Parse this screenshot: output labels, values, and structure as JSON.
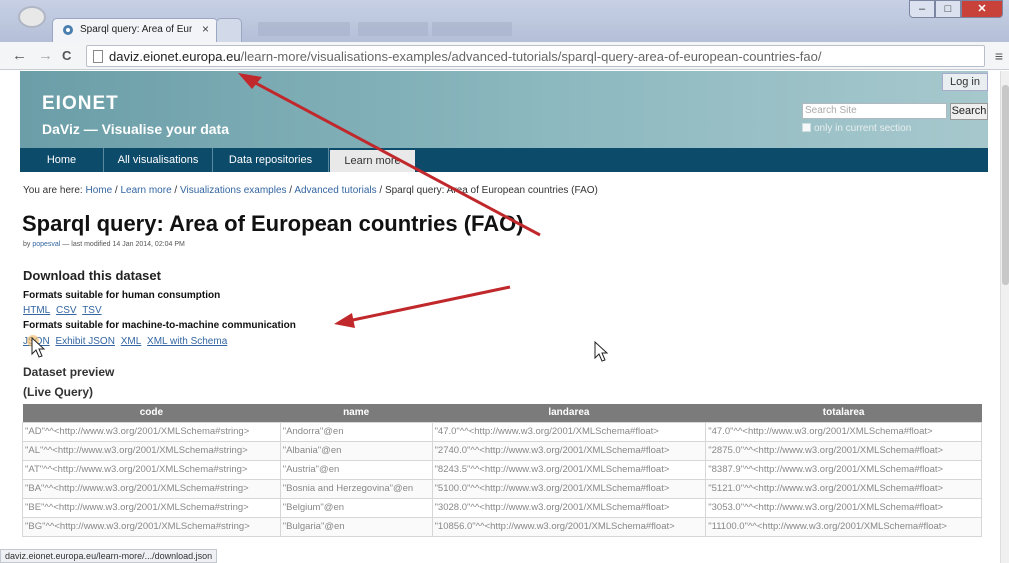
{
  "browser": {
    "tab_title": "Sparql query: Area of Euro",
    "tab_close": "×",
    "url_domain": "daviz.eionet.europa.eu",
    "url_path": "/learn-more/visualisations-examples/advanced-tutorials/sparql-query-area-of-european-countries-fao/",
    "status_url": "daviz.eionet.europa.eu/learn-more/.../download.json",
    "back": "←",
    "forward": "→",
    "reload": "C",
    "menu": "≡",
    "win_min": "–",
    "win_max": "□",
    "win_close": "✕"
  },
  "site": {
    "logo": "EIONET",
    "tagline": "DaViz — Visualise your data",
    "login": "Log in",
    "search_placeholder": "Search Site",
    "search_button": "Search",
    "only_current": "only in current section"
  },
  "nav": {
    "items": [
      "Home",
      "All visualisations",
      "Data repositories",
      "Learn more"
    ]
  },
  "breadcrumb": {
    "prefix": "You are here: ",
    "items": [
      "Home",
      "Learn more",
      "Visualizations examples",
      "Advanced tutorials"
    ],
    "current": "Sparql query: Area of European countries (FAO)",
    "sep": " / "
  },
  "page": {
    "title": "Sparql query: Area of European countries (FAO)",
    "byline_prefix": "by ",
    "author": "popesval",
    "byline_suffix": " — last modified 14 Jan 2014, 02:04 PM",
    "download_heading": "Download this dataset",
    "human_heading": "Formats suitable for human consumption",
    "human_formats": [
      "HTML",
      "CSV",
      "TSV"
    ],
    "machine_heading": "Formats suitable for machine-to-machine communication",
    "machine_formats": [
      "JSON",
      "Exhibit JSON",
      "XML",
      "XML with Schema"
    ],
    "preview_heading": "Dataset preview",
    "live_query": "(Live Query)"
  },
  "table": {
    "headers": [
      "code",
      "name",
      "landarea",
      "totalarea"
    ],
    "rows": [
      [
        "\"AD\"^^<http://www.w3.org/2001/XMLSchema#string>",
        "\"Andorra\"@en",
        "\"47.0\"^^<http://www.w3.org/2001/XMLSchema#float>",
        "\"47.0\"^^<http://www.w3.org/2001/XMLSchema#float>"
      ],
      [
        "\"AL\"^^<http://www.w3.org/2001/XMLSchema#string>",
        "\"Albania\"@en",
        "\"2740.0\"^^<http://www.w3.org/2001/XMLSchema#float>",
        "\"2875.0\"^^<http://www.w3.org/2001/XMLSchema#float>"
      ],
      [
        "\"AT\"^^<http://www.w3.org/2001/XMLSchema#string>",
        "\"Austria\"@en",
        "\"8243.5\"^^<http://www.w3.org/2001/XMLSchema#float>",
        "\"8387.9\"^^<http://www.w3.org/2001/XMLSchema#float>"
      ],
      [
        "\"BA\"^^<http://www.w3.org/2001/XMLSchema#string>",
        "\"Bosnia and Herzegovina\"@en",
        "\"5100.0\"^^<http://www.w3.org/2001/XMLSchema#float>",
        "\"5121.0\"^^<http://www.w3.org/2001/XMLSchema#float>"
      ],
      [
        "\"BE\"^^<http://www.w3.org/2001/XMLSchema#string>",
        "\"Belgium\"@en",
        "\"3028.0\"^^<http://www.w3.org/2001/XMLSchema#float>",
        "\"3053.0\"^^<http://www.w3.org/2001/XMLSchema#float>"
      ],
      [
        "\"BG\"^^<http://www.w3.org/2001/XMLSchema#string>",
        "\"Bulgaria\"@en",
        "\"10856.0\"^^<http://www.w3.org/2001/XMLSchema#float>",
        "\"11100.0\"^^<http://www.w3.org/2001/XMLSchema#float>"
      ]
    ]
  },
  "colors": {
    "annotation_arrow": "#c0282b",
    "nav_bg": "#0d4b6b",
    "link": "#3466a2"
  }
}
